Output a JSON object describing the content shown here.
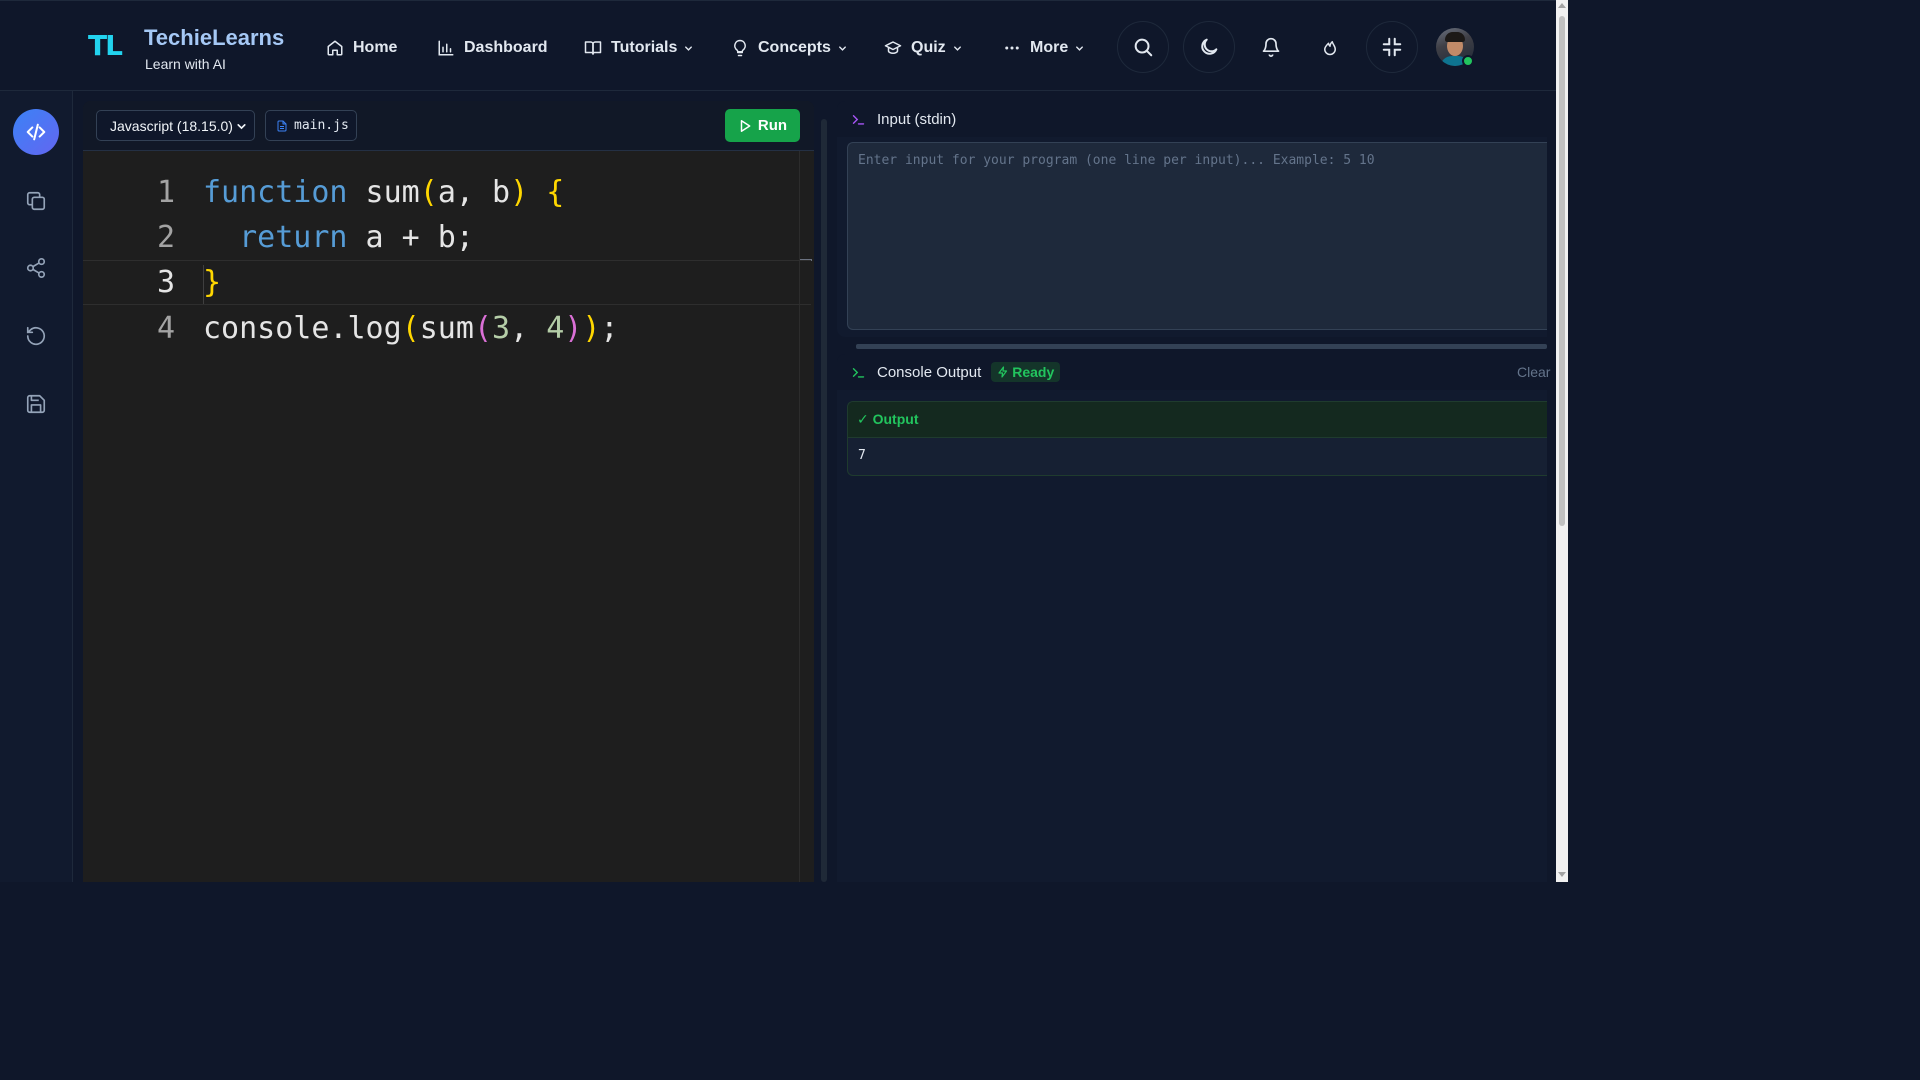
{
  "header": {
    "logo_text": "TL",
    "brand_name": "TechieLearns",
    "tagline": "Learn with AI",
    "nav": [
      {
        "label": "Home",
        "icon": "home-icon"
      },
      {
        "label": "Dashboard",
        "icon": "bar-chart-icon"
      },
      {
        "label": "Tutorials",
        "icon": "book-icon",
        "dropdown": true
      },
      {
        "label": "Concepts",
        "icon": "lightbulb-icon",
        "dropdown": true
      },
      {
        "label": "Quiz",
        "icon": "graduation-cap-icon",
        "dropdown": true
      },
      {
        "label": "More",
        "icon": "ellipsis-icon",
        "dropdown": true
      }
    ],
    "actions": [
      "search-icon",
      "moon-icon",
      "bell-icon",
      "flame-icon",
      "minimize-icon"
    ],
    "avatar_status": "online"
  },
  "sidebar": {
    "items": [
      "code-icon",
      "copy-icon",
      "share-icon",
      "reset-icon",
      "save-icon"
    ],
    "active": "code-icon"
  },
  "editor": {
    "language": "Javascript (18.15.0)",
    "filename": "main.js",
    "run_label": "Run",
    "lines": [
      {
        "n": "1"
      },
      {
        "n": "2"
      },
      {
        "n": "3"
      },
      {
        "n": "4"
      }
    ],
    "code": [
      "function sum(a, b) {",
      "  return a + b;",
      "}",
      "console.log(sum(3, 4));"
    ]
  },
  "input_panel": {
    "title": "Input (stdin)",
    "placeholder": "Enter input for your program (one line per input)... Example: 5 10"
  },
  "output_panel": {
    "title": "Console Output",
    "status": "Ready",
    "clear_label": "Clear",
    "output_label": "✓ Output",
    "output_text": "7"
  },
  "colors": {
    "background": "#0f172a",
    "accent": "#3b82f6",
    "run_button": "#16a34a",
    "success": "#22c55e",
    "editor_bg": "#1e1e1e"
  }
}
